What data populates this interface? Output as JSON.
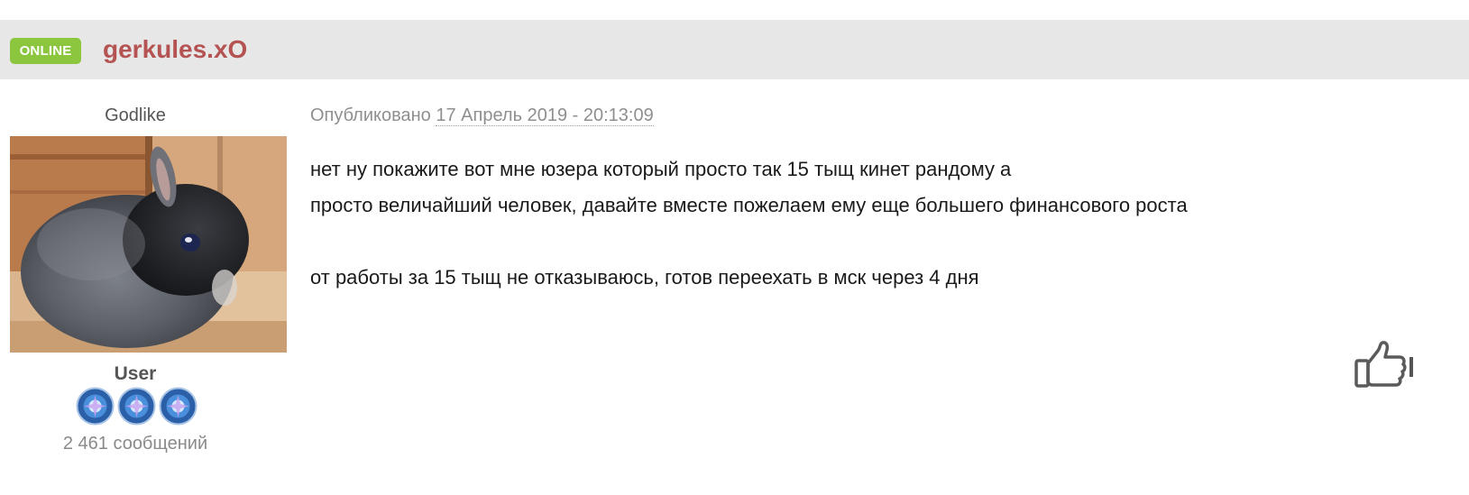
{
  "author": {
    "status_badge": "ONLINE",
    "name": "gerkules.xO",
    "title": "Godlike",
    "group": "User",
    "post_count": "2 461 сообщений",
    "avatar_icon": "rabbit-avatar",
    "rank_icon": "rank-pip-icon"
  },
  "post": {
    "published_label": "Опубликовано",
    "date": "17 Апрель 2019 - 20:13:09",
    "lines": [
      "нет ну покажите вот мне юзера который просто так 15 тыщ кинет рандому а",
      "просто величайший человек, давайте вместе пожелаем ему еще большего финансового роста",
      "",
      "от работы за 15 тыщ не отказываюсь, готов переехать в мск через 4 дня"
    ]
  },
  "actions": {
    "like_icon": "thumbs-up-icon"
  },
  "colors": {
    "header_bg": "#e7e7e7",
    "online_badge": "#8cc63f",
    "author_name": "#b55353",
    "muted_text": "#8f8f8f",
    "body_text": "#1a1a1a"
  }
}
